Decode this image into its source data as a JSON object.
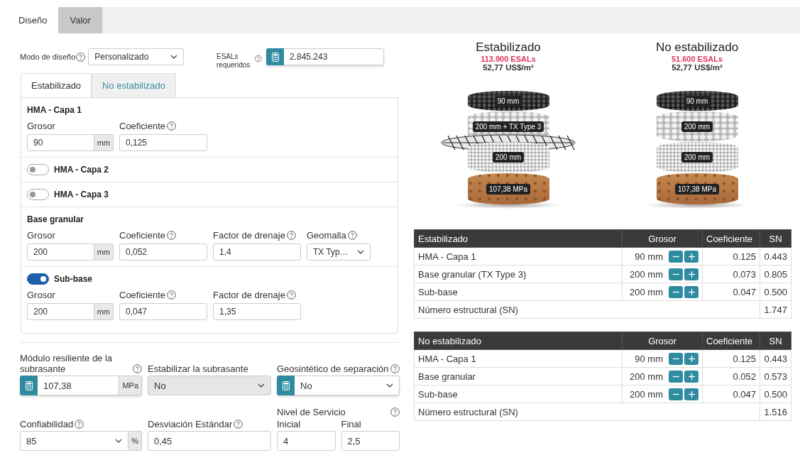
{
  "tabs": [
    {
      "label": "Diseño",
      "selected": true
    },
    {
      "label": "Valor",
      "selected": false
    }
  ],
  "design_mode": {
    "label": "Modo de diseño",
    "help": true,
    "value": "Personalizado"
  },
  "esals": {
    "label": "ESALs requeridos",
    "help": true,
    "value": "2.845.243"
  },
  "layer_tabs": [
    {
      "label": "Estabilizado",
      "selected": true
    },
    {
      "label": "No estabilizado",
      "selected": false
    }
  ],
  "layers": [
    {
      "kind": "fixed",
      "title": "HMA - Capa 1",
      "fields": [
        {
          "kind": "unit",
          "label": "Grosor",
          "help": false,
          "value": "90",
          "unit": "mm"
        },
        {
          "kind": "text",
          "label": "Coeficiente",
          "help": true,
          "value": "0,125"
        }
      ]
    },
    {
      "kind": "toggle",
      "title": "HMA - Capa 2",
      "on": false
    },
    {
      "kind": "toggle",
      "title": "HMA - Capa 3",
      "on": false
    },
    {
      "kind": "fixed",
      "title": "Base granular",
      "fields": [
        {
          "kind": "unit",
          "label": "Grosor",
          "help": false,
          "value": "200",
          "unit": "mm"
        },
        {
          "kind": "text",
          "label": "Coeficiente",
          "help": true,
          "value": "0,052"
        },
        {
          "kind": "text",
          "label": "Factor de drenaje",
          "help": true,
          "value": "1,4"
        },
        {
          "kind": "select",
          "label": "Geomalla",
          "help": true,
          "value": "TX Typ…",
          "disabled": false
        }
      ]
    },
    {
      "kind": "toggle",
      "title": "Sub-base",
      "on": true,
      "fields": [
        {
          "kind": "unit",
          "label": "Grosor",
          "help": false,
          "value": "200",
          "unit": "mm"
        },
        {
          "kind": "text",
          "label": "Coeficiente",
          "help": true,
          "value": "0,047"
        },
        {
          "kind": "text",
          "label": "Factor de drenaje",
          "help": true,
          "value": "1,35"
        }
      ]
    }
  ],
  "subgrade_fields": [
    {
      "kind": "calc-unit",
      "label": "Módulo resiliente de la subrasante",
      "help": true,
      "value": "107,38",
      "unit": "MPa"
    },
    {
      "kind": "select",
      "label": "Estabilizar la subrasante",
      "help": false,
      "value": "No",
      "disabled": true
    },
    {
      "kind": "calc-select",
      "label": "Geosintético de separación",
      "help": true,
      "value": "No",
      "disabled": false
    }
  ],
  "design_fields": [
    {
      "kind": "select-unit",
      "label": "Confiabilidad",
      "help": true,
      "value": "85",
      "unit": "%",
      "disabled": false
    },
    {
      "kind": "text",
      "label": "Desviación Estándar",
      "help": true,
      "value": "0,45"
    },
    {
      "kind": "pair",
      "label": "Nivel de Servicio",
      "help": true,
      "items": [
        {
          "label": "Inicial",
          "value": "4"
        },
        {
          "label": "Final",
          "value": "2,5"
        }
      ]
    }
  ],
  "results": [
    {
      "title": "Estabilizado",
      "esals": "113.900 ESALs",
      "cost": "52,77 US$/m²",
      "layers": [
        {
          "kind": "asphalt",
          "label": "90 mm",
          "geogrid": false
        },
        {
          "kind": "coarse",
          "label": "200 mm + TX Type 3",
          "geogrid": true
        },
        {
          "kind": "fine",
          "label": "200 mm",
          "geogrid": false
        },
        {
          "kind": "soil",
          "label": "107,38 MPa",
          "geogrid": false
        }
      ]
    },
    {
      "title": "No estabilizado",
      "esals": "51.600 ESALs",
      "cost": "52,77 US$/m²",
      "layers": [
        {
          "kind": "asphalt",
          "label": "90 mm",
          "geogrid": false
        },
        {
          "kind": "coarse",
          "label": "200 mm",
          "geogrid": false
        },
        {
          "kind": "fine",
          "label": "200 mm",
          "geogrid": false
        },
        {
          "kind": "soil",
          "label": "107,38 MPa",
          "geogrid": false
        }
      ]
    }
  ],
  "tables": [
    {
      "columns": [
        "Estabilizado",
        "Grosor",
        "Coeficiente",
        "SN"
      ],
      "rows": [
        {
          "layer": "HMA - Capa 1",
          "thickness": "90 mm",
          "coefficient": "0.125",
          "sn": "0.443"
        },
        {
          "layer": "Base granular (TX Type 3)",
          "thickness": "200 mm",
          "coefficient": "0.073",
          "sn": "0.805"
        },
        {
          "layer": "Sub-base",
          "thickness": "200 mm",
          "coefficient": "0.047",
          "sn": "0.500"
        }
      ],
      "total": {
        "label": "Número estructural (SN)",
        "value": "1.747"
      }
    },
    {
      "columns": [
        "No estabilizado",
        "Grosor",
        "Coeficiente",
        "SN"
      ],
      "rows": [
        {
          "layer": "HMA - Capa 1",
          "thickness": "90 mm",
          "coefficient": "0.125",
          "sn": "0.443"
        },
        {
          "layer": "Base granular",
          "thickness": "200 mm",
          "coefficient": "0.052",
          "sn": "0.573"
        },
        {
          "layer": "Sub-base",
          "thickness": "200 mm",
          "coefficient": "0.047",
          "sn": "0.500"
        }
      ],
      "total": {
        "label": "Número estructural (SN)",
        "value": "1.516"
      }
    }
  ]
}
